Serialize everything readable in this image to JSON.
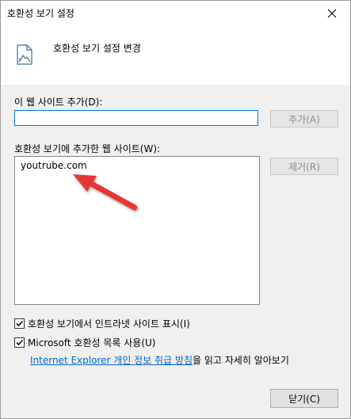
{
  "window": {
    "title": "호환성 보기 설정"
  },
  "header": {
    "text": "호환성 보기 설정 변경"
  },
  "add_site": {
    "label": "이 웹 사이트 추가(D):",
    "input_value": "",
    "add_button": "추가(A)"
  },
  "site_list": {
    "label": "호환성 보기에 추가한 웹 사이트(W):",
    "items": [
      "youtrube.com"
    ],
    "remove_button": "제거(R)"
  },
  "options": {
    "intranet": {
      "label": "호환성 보기에서 인트라넷 사이트 표시(I)",
      "checked": true
    },
    "ms_list": {
      "label": "Microsoft 호환성 목록 사용(U)",
      "checked": true
    }
  },
  "privacy": {
    "link_text": "Internet Explorer 개인 정보 취급 방침",
    "suffix": "을 읽고 자세히 알아보기"
  },
  "footer": {
    "close_button": "닫기(C)"
  },
  "colors": {
    "accent": "#0078d7",
    "arrow": "#e53935",
    "link": "#0066cc"
  },
  "icons": [
    "close-icon",
    "compat-page-icon",
    "checkmark-icon",
    "arrow-annotation-icon"
  ]
}
